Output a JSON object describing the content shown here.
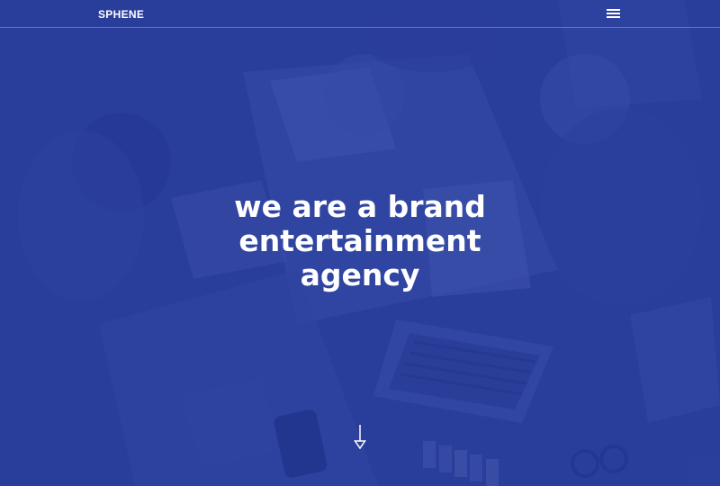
{
  "navbar": {
    "logo": "SPHENE",
    "menu_icon": "hamburger-menu-icon"
  },
  "hero": {
    "headline": "we are a brand\nentertainment\nagency",
    "scroll_icon": "arrow-down-icon"
  },
  "colors": {
    "overlay": "#2b3f9c",
    "text": "#ffffff"
  }
}
